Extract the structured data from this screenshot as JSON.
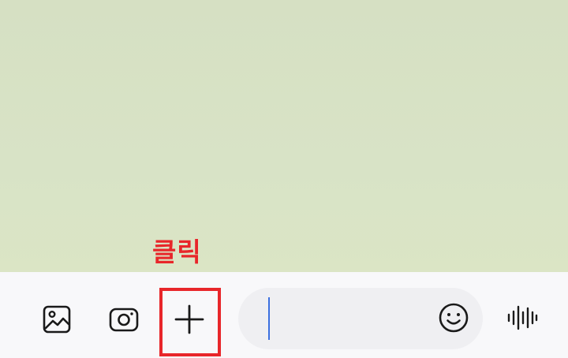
{
  "annotation": {
    "label": "클릭",
    "color": "#e8262a"
  },
  "toolbar": {
    "gallery_icon": "gallery-icon",
    "camera_icon": "camera-icon",
    "plus_icon": "plus-icon",
    "emoji_icon": "emoji-icon",
    "voice_icon": "voice-waveform-icon"
  },
  "message_input": {
    "value": "",
    "placeholder": "",
    "caret_color": "#3b6fe0"
  },
  "colors": {
    "chat_background": "#d8e3c6",
    "input_bar_background": "#f8f8fa",
    "field_background": "#efeff2",
    "highlight": "#e8262a"
  }
}
